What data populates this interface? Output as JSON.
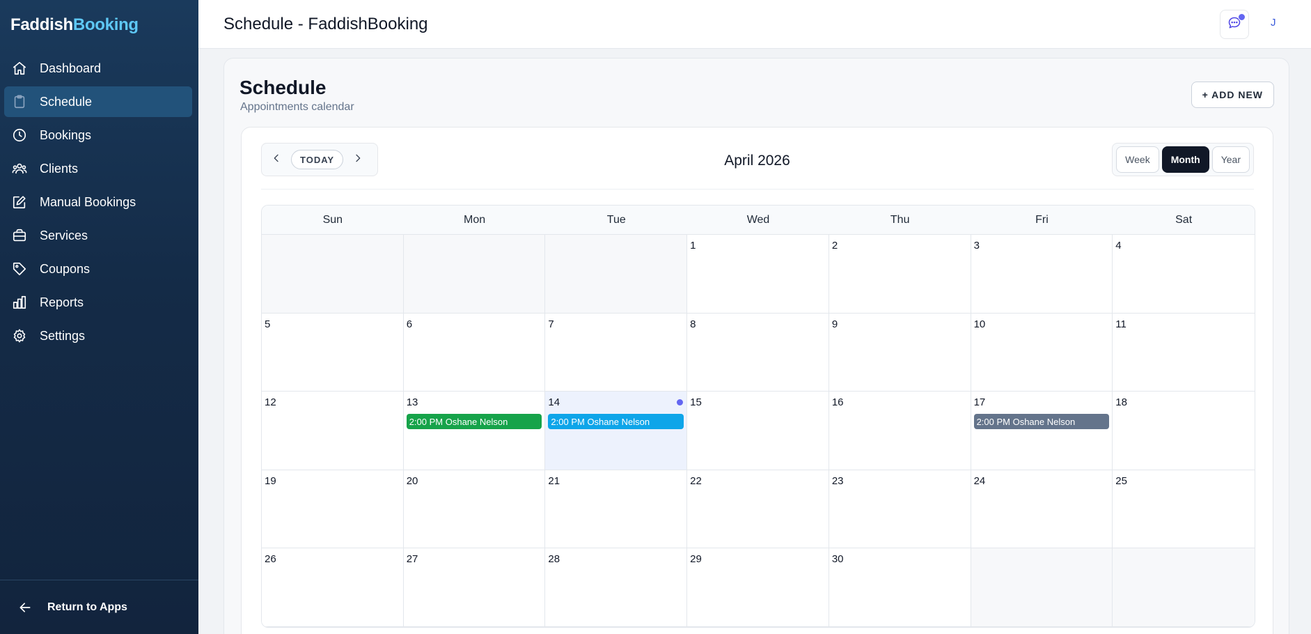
{
  "brand": {
    "part1": "Faddish",
    "part2": "Booking"
  },
  "sidebar": {
    "items": [
      {
        "label": "Dashboard",
        "icon": "home-icon"
      },
      {
        "label": "Schedule",
        "icon": "clipboard-icon",
        "active": true
      },
      {
        "label": "Bookings",
        "icon": "clock-icon"
      },
      {
        "label": "Clients",
        "icon": "users-icon"
      },
      {
        "label": "Manual Bookings",
        "icon": "edit-icon"
      },
      {
        "label": "Services",
        "icon": "briefcase-icon"
      },
      {
        "label": "Coupons",
        "icon": "tag-icon"
      },
      {
        "label": "Reports",
        "icon": "bar-chart-icon"
      },
      {
        "label": "Settings",
        "icon": "gear-icon"
      }
    ],
    "footer_label": "Return to Apps"
  },
  "header": {
    "title": "Schedule - FaddishBooking",
    "avatar_initial": "J"
  },
  "panel": {
    "title": "Schedule",
    "subtitle": "Appointments calendar",
    "add_new_label": "+ ADD NEW"
  },
  "calendar": {
    "today_label": "TODAY",
    "month_label": "April 2026",
    "views": [
      "Week",
      "Month",
      "Year"
    ],
    "active_view": "Month",
    "weekdays": [
      "Sun",
      "Mon",
      "Tue",
      "Wed",
      "Thu",
      "Fri",
      "Sat"
    ],
    "days": [
      "",
      "",
      "",
      "1",
      "2",
      "3",
      "4",
      "5",
      "6",
      "7",
      "8",
      "9",
      "10",
      "11",
      "12",
      "13",
      "14",
      "15",
      "16",
      "17",
      "18",
      "19",
      "20",
      "21",
      "22",
      "23",
      "24",
      "25",
      "26",
      "27",
      "28",
      "29",
      "30",
      "",
      ""
    ],
    "today": "14",
    "events": [
      {
        "day": "13",
        "label": "2:00 PM Oshane Nelson",
        "color": "#16a34a"
      },
      {
        "day": "14",
        "label": "2:00 PM Oshane Nelson",
        "color": "#0ea5e9"
      },
      {
        "day": "17",
        "label": "2:00 PM Oshane Nelson",
        "color": "#64748b"
      }
    ]
  },
  "colors": {
    "sidebar_bg": "#142b47",
    "sidebar_active": "#22527a",
    "brand_accent": "#5ec8f5",
    "notification_dot": "#6366f1"
  }
}
